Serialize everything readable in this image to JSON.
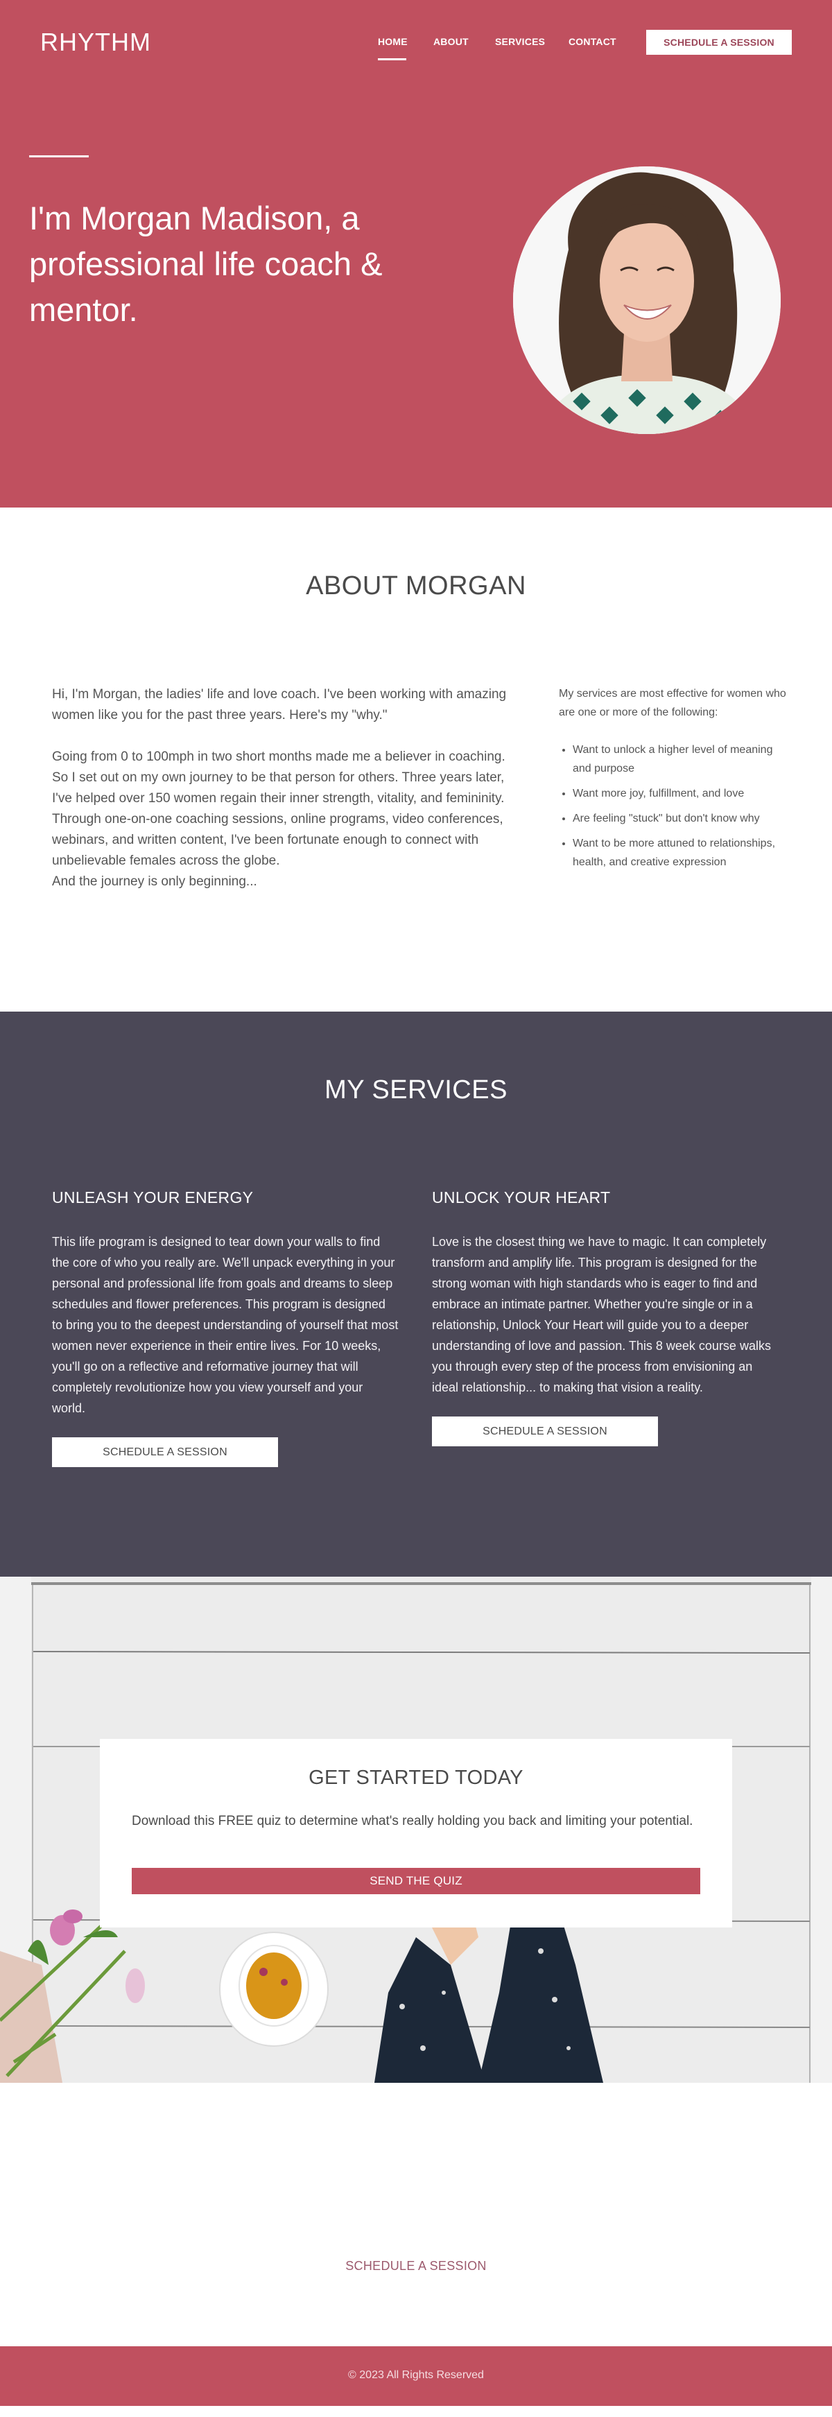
{
  "brand": {
    "logo": "RHYTHM",
    "accent": "#C0505F",
    "dark": "#4B4857"
  },
  "nav": {
    "items": [
      {
        "label": "HOME",
        "active": true
      },
      {
        "label": "ABOUT",
        "active": false
      },
      {
        "label": "SERVICES",
        "active": false
      },
      {
        "label": "CONTACT",
        "active": false
      }
    ],
    "cta_label": "SCHEDULE A SESSION"
  },
  "hero": {
    "title": "I'm Morgan Madison, a professional life coach & mentor.",
    "portrait_alt": "Smiling woman with curly brown hair"
  },
  "about": {
    "title": "ABOUT MORGAN",
    "paragraphs": [
      "Hi, I'm Morgan, the ladies' life and love coach. I've been working with amazing women like you for the past three years. Here's my \"why.\"",
      "Going from 0 to 100mph in two short months made me a believer in coaching. So I set out on my own journey to be that person for others. Three years later, I've helped over 150 women regain their inner strength, vitality, and femininity. Through one-on-one coaching sessions, online programs, video conferences, webinars, and written content, I've been fortunate enough to connect with unbelievable females across the globe.",
      "And the journey is only beginning..."
    ],
    "side_intro": "My services are most effective for women who are one or more of the following:",
    "side_list": [
      "Want to unlock a higher level of meaning and purpose",
      "Want more joy, fulfillment, and love",
      "Are feeling \"stuck\" but don't know why",
      "Want to be more attuned to relationships, health, and creative expression"
    ]
  },
  "services": {
    "title": "MY SERVICES",
    "items": [
      {
        "title": "UNLEASH YOUR ENERGY",
        "body": "This life program is designed to tear down your walls to find the core of who you really are. We'll unpack everything in your personal and professional life from goals and dreams to sleep schedules and flower preferences. This program is designed to bring you to the deepest understanding of yourself that most women never experience in their entire lives. For 10 weeks, you'll go on a reflective and reformative journey that will completely revolutionize how you view yourself and your world.",
        "button": "SCHEDULE A SESSION"
      },
      {
        "title": "UNLOCK YOUR HEART",
        "body": "Love is the closest thing we have to magic. It can completely transform and amplify life. This program is designed for the strong woman with high standards who is eager to find and embrace an intimate partner. Whether you're single or in a relationship, Unlock Your Heart will guide you to a deeper understanding of love and passion. This 8 week course walks you through every step of the process from envisioning an ideal relationship... to making that vision a reality.",
        "button": "SCHEDULE A SESSION"
      }
    ]
  },
  "get_started": {
    "title": "GET STARTED TODAY",
    "body": "Download this FREE quiz to determine what's really holding you back and limiting your potential.",
    "button": "SEND THE QUIZ"
  },
  "cta": {
    "link": "SCHEDULE A SESSION"
  },
  "footer": {
    "copyright": "© 2023 All Rights Reserved"
  }
}
